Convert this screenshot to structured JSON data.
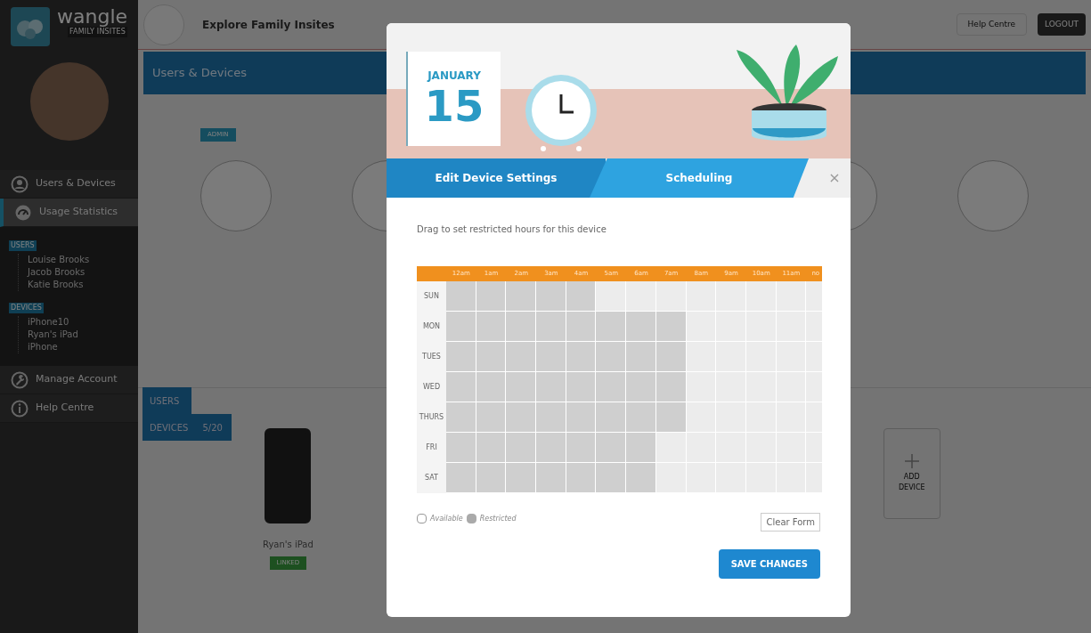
{
  "sidebar": {
    "logo": {
      "name": "wangle",
      "tagline": "FAMILY INSITES"
    },
    "nav": [
      {
        "label": "Users & Devices",
        "selected": false
      },
      {
        "label": "Usage Statistics",
        "selected": true,
        "groups": [
          {
            "label": "USERS",
            "items": [
              "Louise Brooks",
              "Jacob Brooks",
              "Katie Brooks"
            ]
          },
          {
            "label": "DEVICES",
            "items": [
              "iPhone10",
              "Ryan's iPad",
              "iPhone"
            ]
          }
        ]
      },
      {
        "label": "Manage Account",
        "selected": false
      },
      {
        "label": "Help Centre",
        "selected": false
      }
    ]
  },
  "top_bar": {
    "explore": "Explore Family Insites",
    "help": "Help Centre",
    "logout": "LOGOUT"
  },
  "banner": {
    "title": "Users & Devices"
  },
  "users_section": {
    "badge": "ADMIN"
  },
  "section_tabs": [
    {
      "label": "USERS"
    },
    {
      "label": "DEVICES",
      "count": "5/20"
    }
  ],
  "devices": [
    {
      "name": "Ryan's iPad",
      "status": "LINKED"
    }
  ],
  "add_device": {
    "label": "ADD DEVICE"
  },
  "modal": {
    "calendar": {
      "month": "JANUARY",
      "day": "15"
    },
    "tabs": [
      {
        "label": "Edit Device Settings",
        "selected": false
      },
      {
        "label": "Scheduling",
        "selected": true
      }
    ],
    "close": "×",
    "instructions": "Drag to set restricted hours for this device",
    "schedule": {
      "hours": [
        "12am",
        "1am",
        "2am",
        "3am",
        "4am",
        "5am",
        "6am",
        "7am",
        "8am",
        "9am",
        "10am",
        "11am",
        "no"
      ],
      "days": [
        {
          "label": "SUN",
          "restricted": [
            true,
            true,
            true,
            true,
            true,
            false,
            false,
            false,
            false,
            false,
            false,
            false,
            false
          ]
        },
        {
          "label": "MON",
          "restricted": [
            true,
            true,
            true,
            true,
            true,
            true,
            true,
            true,
            false,
            false,
            false,
            false,
            false
          ]
        },
        {
          "label": "TUES",
          "restricted": [
            true,
            true,
            true,
            true,
            true,
            true,
            true,
            true,
            false,
            false,
            false,
            false,
            false
          ]
        },
        {
          "label": "WED",
          "restricted": [
            true,
            true,
            true,
            true,
            true,
            true,
            true,
            true,
            false,
            false,
            false,
            false,
            false
          ]
        },
        {
          "label": "THURS",
          "restricted": [
            true,
            true,
            true,
            true,
            true,
            true,
            true,
            true,
            false,
            false,
            false,
            false,
            false
          ]
        },
        {
          "label": "FRI",
          "restricted": [
            true,
            true,
            true,
            true,
            true,
            true,
            true,
            false,
            false,
            false,
            false,
            false,
            false
          ]
        },
        {
          "label": "SAT",
          "restricted": [
            true,
            true,
            true,
            true,
            true,
            true,
            true,
            false,
            false,
            false,
            false,
            false,
            false
          ]
        }
      ]
    },
    "legend": [
      {
        "label": "Available",
        "kind": "available"
      },
      {
        "label": "Restricted",
        "kind": "restricted"
      }
    ],
    "clear_button": "Clear Form",
    "save_button": "SAVE CHANGES"
  }
}
